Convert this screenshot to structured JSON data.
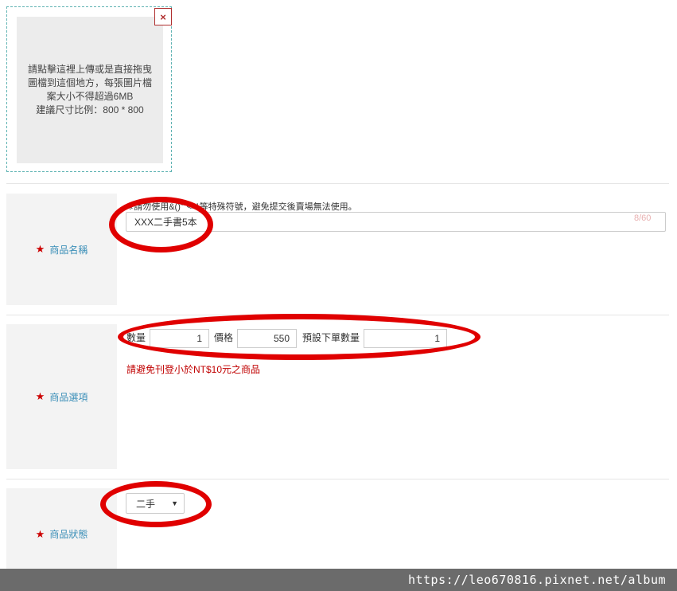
{
  "upload": {
    "instructions_line1": "請點擊這裡上傳或是直接拖曳圖檔到這個地方，每張圖片檔案大小不得超過6MB",
    "instructions_line2": "建議尺寸比例：800 * 800",
    "close_label": "×"
  },
  "name_section": {
    "label": "商品名稱",
    "star": "★",
    "hint": "※請勿使用&()\"\"<>\\等特殊符號，避免提交後賣場無法使用。",
    "value": "XXX二手書5本",
    "counter": "8/60"
  },
  "options_section": {
    "label": "商品選項",
    "star": "★",
    "quantity_label": "數量",
    "quantity_value": "1",
    "price_label": "價格",
    "price_value": "550",
    "default_order_label": "預設下單數量",
    "default_order_value": "1",
    "warning": "請避免刊登小於NT$10元之商品"
  },
  "status_section": {
    "label": "商品狀態",
    "star": "★",
    "selected": "二手",
    "caret": "▼"
  },
  "watermark": {
    "text": "https://leo670816.pixnet.net/album"
  },
  "colors": {
    "annotation_ring": "#e00000",
    "label_text": "#3b8fb8",
    "warning": "#c00000",
    "star": "#cc0000"
  }
}
